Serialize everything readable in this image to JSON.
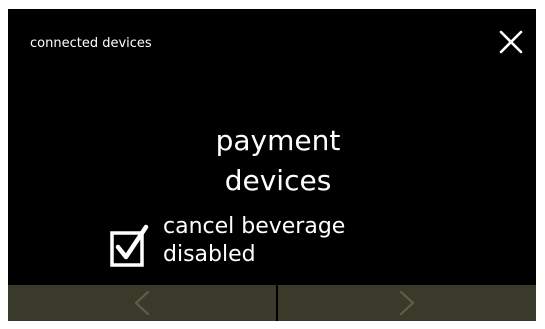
{
  "header": {
    "title": "connected devices",
    "close_icon": "close-icon"
  },
  "main": {
    "title": "payment\ndevices",
    "option": {
      "label": "cancel beverage\ndisabled",
      "checked": true,
      "icon": "checkbox-checked-icon"
    }
  },
  "footer": {
    "prev_icon": "chevron-left-icon",
    "next_icon": "chevron-right-icon"
  },
  "colors": {
    "screen_background": "#000000",
    "text": "#ffffff",
    "footer_background": "#3a3a2b",
    "nav_arrow": "#5e5e48"
  }
}
